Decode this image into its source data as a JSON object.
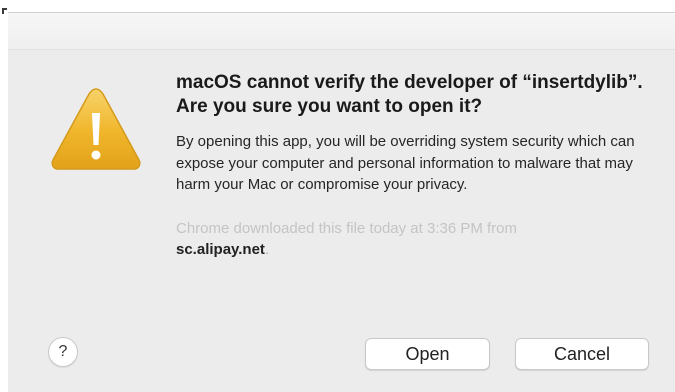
{
  "dialog": {
    "heading": "macOS cannot verify the developer of “insertdylib”. Are you sure you want to open it?",
    "body": "By opening this app, you will be overriding system security which can expose your computer and personal information to malware that may harm your Mac or compromise your privacy.",
    "source_text": "Chrome downloaded this file today at 3:36 PM from",
    "source_host": "sc.alipay.net",
    "source_period": ".",
    "icon": "warning-triangle-icon",
    "icon_color": "#f2b01e"
  },
  "buttons": {
    "help_label": "?",
    "open_label": "Open",
    "cancel_label": "Cancel"
  }
}
